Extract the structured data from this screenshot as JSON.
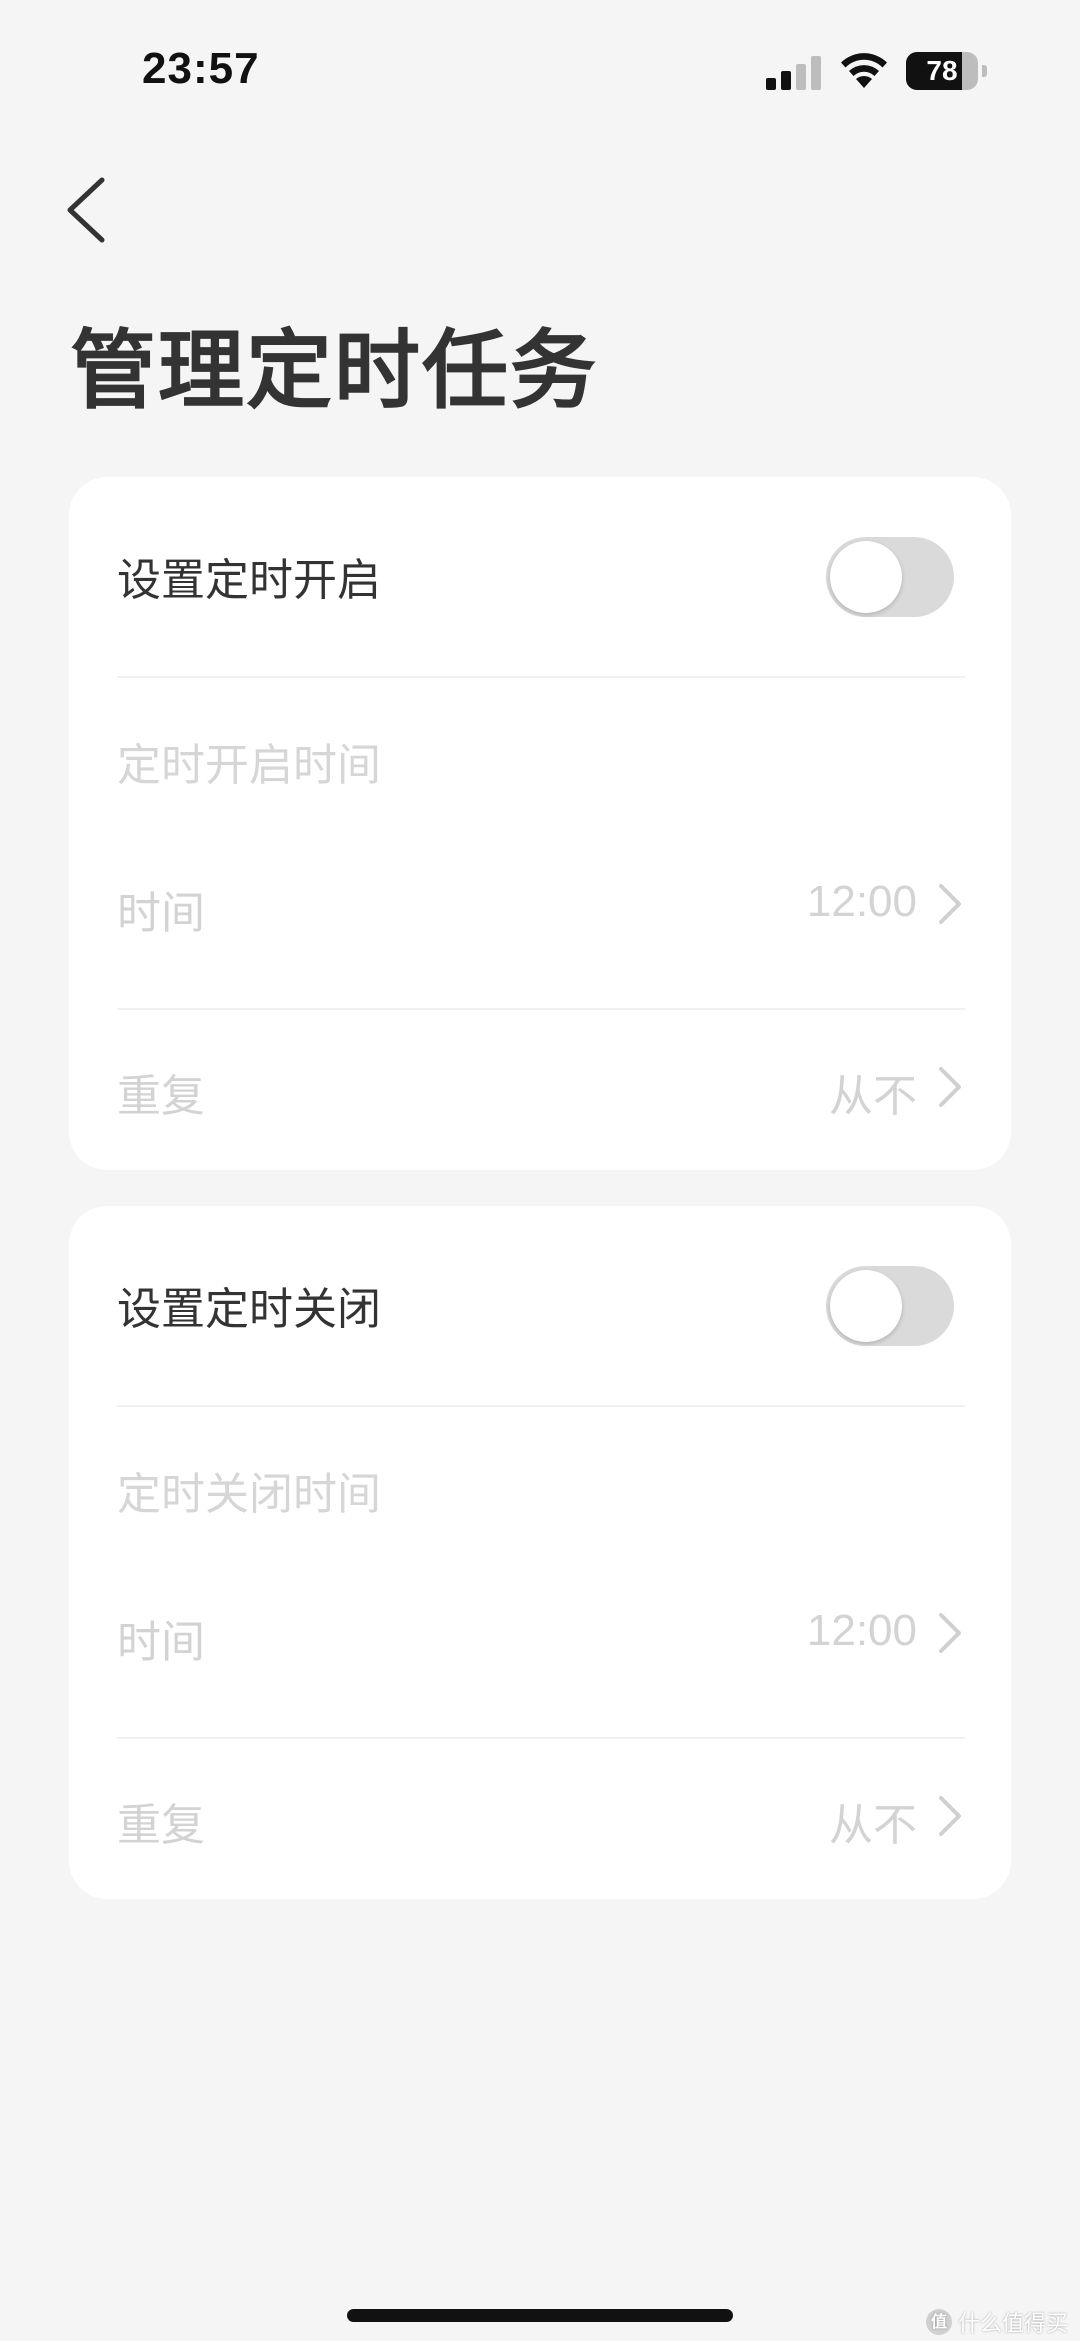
{
  "status_bar": {
    "time": "23:57",
    "battery_level": "78",
    "battery_fraction": 0.78
  },
  "header": {
    "back_icon": "chevron-left-icon",
    "title": "管理定时任务"
  },
  "timer_on": {
    "toggle_label": "设置定时开启",
    "toggle_state": false,
    "section_label": "定时开启时间",
    "time_label": "时间",
    "time_value": "12:00",
    "repeat_label": "重复",
    "repeat_value": "从不"
  },
  "timer_off": {
    "toggle_label": "设置定时关闭",
    "toggle_state": false,
    "section_label": "定时关闭时间",
    "time_label": "时间",
    "time_value": "12:00",
    "repeat_label": "重复",
    "repeat_value": "从不"
  },
  "watermark": {
    "badge": "值",
    "text": "什么值得买"
  },
  "colors": {
    "background": "#f5f5f5",
    "card": "#ffffff",
    "title_text": "#333333",
    "disabled_text": "#d3d3d3",
    "toggle_off": "#dadada"
  }
}
